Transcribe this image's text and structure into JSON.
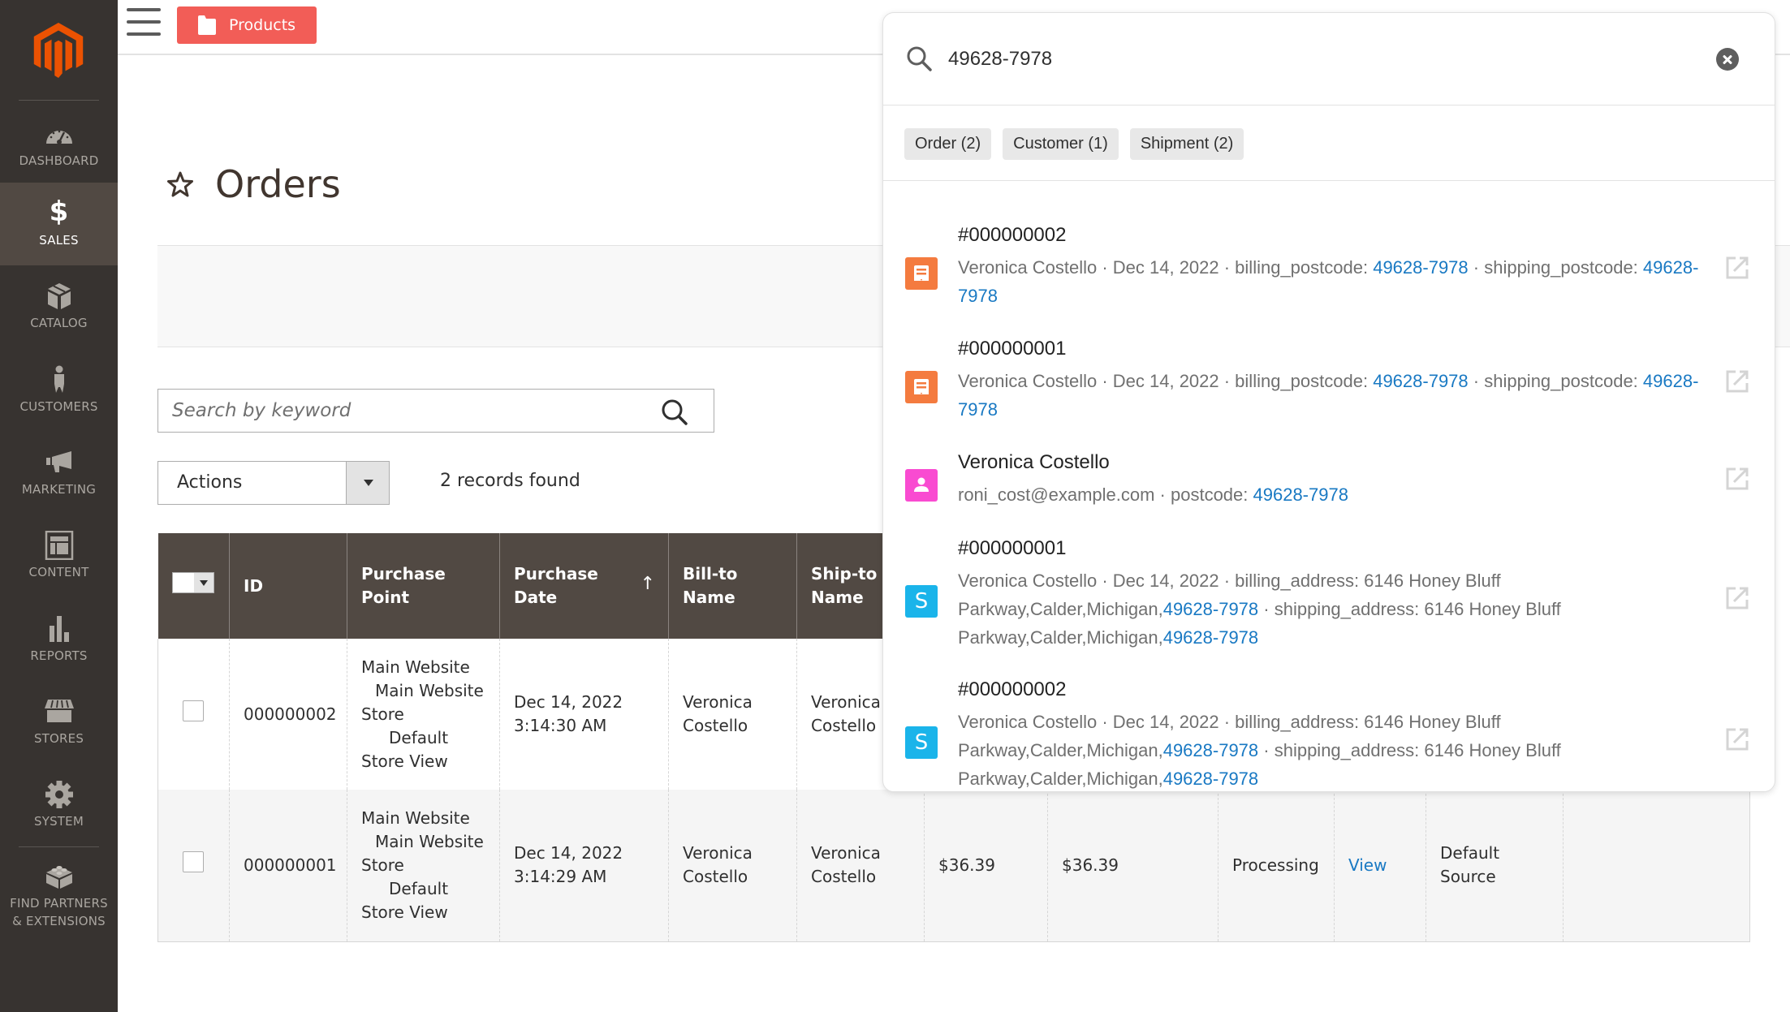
{
  "sidebar": {
    "logo": "magento-logo",
    "items": [
      {
        "label": "DASHBOARD",
        "icon": "dashboard-icon",
        "active": false
      },
      {
        "label": "SALES",
        "icon": "dollar-icon",
        "active": true
      },
      {
        "label": "CATALOG",
        "icon": "box-icon",
        "active": false
      },
      {
        "label": "CUSTOMERS",
        "icon": "person-icon",
        "active": false
      },
      {
        "label": "MARKETING",
        "icon": "megaphone-icon",
        "active": false
      },
      {
        "label": "CONTENT",
        "icon": "layout-icon",
        "active": false
      },
      {
        "label": "REPORTS",
        "icon": "bar-chart-icon",
        "active": false
      },
      {
        "label": "STORES",
        "icon": "storefront-icon",
        "active": false
      },
      {
        "label": "SYSTEM",
        "icon": "gear-icon",
        "active": false
      },
      {
        "label": "FIND PARTNERS & EXTENSIONS",
        "label_line1": "FIND PARTNERS",
        "label_line2": "& EXTENSIONS",
        "icon": "lego-block-icon",
        "active": false
      }
    ]
  },
  "header": {
    "products_button": "Products"
  },
  "page": {
    "title": "Orders"
  },
  "grid": {
    "search_placeholder": "Search by keyword",
    "actions_label": "Actions",
    "records_found": "2 records found",
    "columns": [
      "",
      "ID",
      "Purchase Point",
      "Purchase Date",
      "Bill-to Name",
      "Ship-to Name",
      "",
      "",
      "",
      "",
      "",
      ""
    ],
    "header_lines": {
      "id": "ID",
      "purchase_point_1": "Purchase",
      "purchase_point_2": "Point",
      "purchase_date_1": "Purchase",
      "purchase_date_2": "Date",
      "bill_to_1": "Bill-to",
      "bill_to_2": "Name",
      "ship_to_1": "Ship-to",
      "ship_to_2": "Name",
      "sort_indicator": "↑"
    },
    "rows": [
      {
        "id": "000000002",
        "purchase_point": [
          "Main Website",
          "Main Website",
          "Store",
          "Default",
          "Store View"
        ],
        "purchase_date_1": "Dec 14, 2022",
        "purchase_date_2": "3:14:30 AM",
        "bill_to_1": "Veronica",
        "bill_to_2": "Costello",
        "ship_to_1": "Veronica",
        "ship_to_2": "Costello"
      },
      {
        "id": "000000001",
        "purchase_point": [
          "Main Website",
          "Main Website",
          "Store",
          "Default",
          "Store View"
        ],
        "purchase_date_1": "Dec 14, 2022",
        "purchase_date_2": "3:14:29 AM",
        "bill_to_1": "Veronica",
        "bill_to_2": "Costello",
        "ship_to_1": "Veronica",
        "ship_to_2": "Costello",
        "grand_total_base": "$36.39",
        "grand_total_purchased": "$36.39",
        "status": "Processing",
        "action": "View",
        "allocated_sources_1": "Default",
        "allocated_sources_2": "Source"
      }
    ]
  },
  "global_search": {
    "query": "49628-7978",
    "chips": [
      "Order (2)",
      "Customer (1)",
      "Shipment (2)"
    ],
    "results": [
      {
        "type": "order",
        "icon": "order-icon",
        "title": "#000000002",
        "meta_parts": [
          "Veronica Costello · Dec 14, 2022 · billing_postcode: ",
          "49628-7978",
          " · shipping_postcode: ",
          "49628-7978"
        ]
      },
      {
        "type": "order",
        "icon": "order-icon",
        "title": "#000000001",
        "meta_parts": [
          "Veronica Costello · Dec 14, 2022 · billing_postcode: ",
          "49628-7978",
          " · shipping_postcode: ",
          "49628-7978"
        ]
      },
      {
        "type": "customer",
        "icon": "customer-icon",
        "title": "Veronica Costello",
        "meta_parts": [
          "roni_cost@example.com · postcode: ",
          "49628-7978"
        ]
      },
      {
        "type": "shipment",
        "icon": "shipment-icon",
        "icon_letter": "S",
        "title": "#000000001",
        "meta_parts": [
          "Veronica Costello · Dec 14, 2022 · billing_address: 6146 Honey Bluff Parkway,Calder,Michigan,",
          "49628-7978",
          " · shipping_address: 6146 Honey Bluff Parkway,Calder,Michigan,",
          "49628-7978"
        ]
      },
      {
        "type": "shipment",
        "icon": "shipment-icon",
        "icon_letter": "S",
        "title": "#000000002",
        "meta_parts": [
          "Veronica Costello · Dec 14, 2022 · billing_address: 6146 Honey Bluff Parkway,Calder,Michigan,",
          "49628-7978",
          " · shipping_address: 6146 Honey Bluff Parkway,Calder,Michigan,",
          "49628-7978"
        ]
      }
    ]
  },
  "colors": {
    "sidebar_bg": "#373330",
    "sidebar_active_bg": "#514943",
    "logo_orange": "#eb5202",
    "products_button": "#f25d57",
    "table_header_bg": "#514943",
    "link_blue": "#1979c3",
    "order_icon_bg": "#f47b3f",
    "customer_icon_bg": "#f94bd1",
    "shipment_icon_bg": "#1ab4ea"
  }
}
